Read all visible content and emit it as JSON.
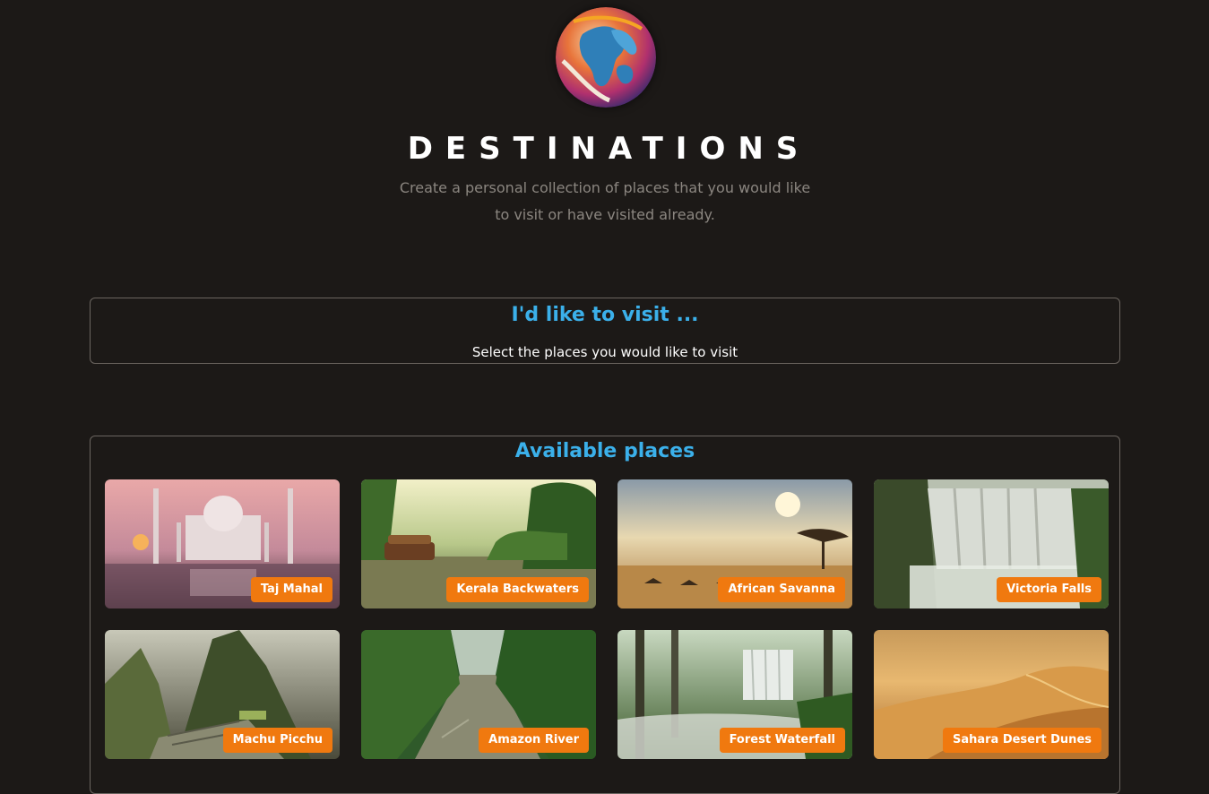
{
  "header": {
    "logo_alt": "Globe logo",
    "title": "DESTINATIONS",
    "subtitle": "Create a personal collection of places that you would like to visit or have visited already."
  },
  "visit_section": {
    "title": "I'd like to visit ...",
    "fallback_text": "Select the places you would like to visit"
  },
  "available_section": {
    "title": "Available places",
    "places": [
      {
        "title": "Taj Mahal"
      },
      {
        "title": "Kerala Backwaters"
      },
      {
        "title": "African Savanna"
      },
      {
        "title": "Victoria Falls"
      },
      {
        "title": "Machu Picchu"
      },
      {
        "title": "Amazon River"
      },
      {
        "title": "Forest Waterfall"
      },
      {
        "title": "Sahara Desert Dunes"
      }
    ]
  },
  "colors": {
    "background": "#1c1917",
    "accent": "#3bb0ea",
    "badge": "#f0790f",
    "border": "#6b6560"
  }
}
